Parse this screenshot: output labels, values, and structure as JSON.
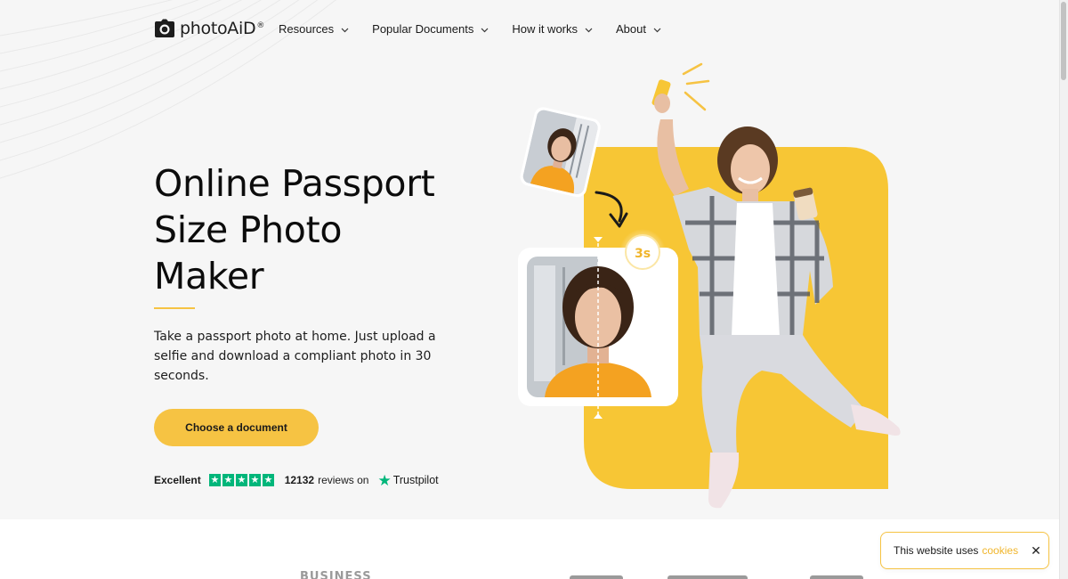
{
  "nav": {
    "logo_text": "photoAiD",
    "logo_reg": "®",
    "menu": [
      {
        "label": "Resources"
      },
      {
        "label": "Popular Documents"
      },
      {
        "label": "How it works"
      },
      {
        "label": "About"
      }
    ]
  },
  "hero": {
    "title_lines": [
      "Online Passport",
      "Size Photo",
      "Maker"
    ],
    "description": "Take a passport photo at home. Just upload a selfie and download a compliant photo in 30 seconds.",
    "cta_label": "Choose a document",
    "rating": {
      "word": "Excellent",
      "stars": 5,
      "reviews_count": "12132",
      "reviews_suffix": "reviews on",
      "provider": "Trustpilot"
    }
  },
  "illustration": {
    "timer_label": "3s"
  },
  "cookie": {
    "text": "This website uses",
    "link": "cookies",
    "close": "✕"
  },
  "press_logos": [
    {
      "label": "BUSINESS"
    }
  ],
  "colors": {
    "accent": "#f6c343",
    "trustpilot": "#00b67a",
    "hero_bg": "#f6f6f6"
  }
}
